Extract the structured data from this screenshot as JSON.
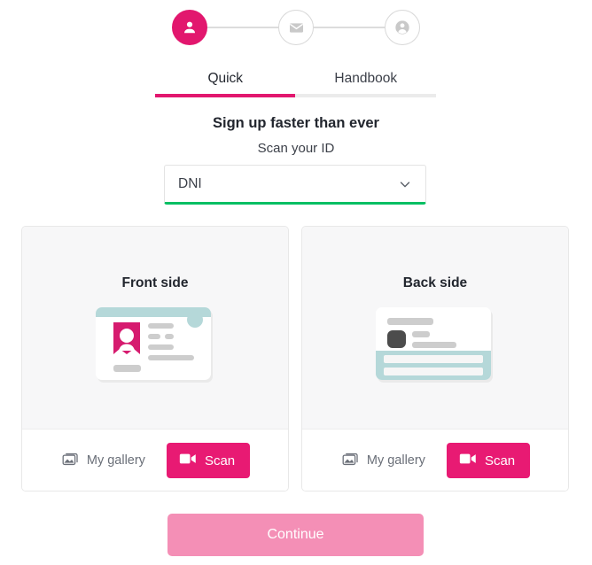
{
  "stepper": {
    "steps": [
      {
        "icon": "person-icon",
        "state": "active"
      },
      {
        "icon": "envelope-icon",
        "state": "inactive"
      },
      {
        "icon": "account-circle-icon",
        "state": "inactive"
      }
    ]
  },
  "tabs": [
    {
      "label": "Quick",
      "active": true
    },
    {
      "label": "Handbook",
      "active": false
    }
  ],
  "headings": {
    "title": "Sign up faster than ever",
    "subtitle": "Scan your ID"
  },
  "document_select": {
    "value": "DNI",
    "icon": "chevron-down-icon",
    "options": [
      "DNI"
    ]
  },
  "cards": [
    {
      "title": "Front side",
      "illustration": "id-card-front-illustration",
      "gallery_label": "My gallery",
      "gallery_icon": "image-icon",
      "scan_label": "Scan",
      "scan_icon": "video-camera-icon"
    },
    {
      "title": "Back side",
      "illustration": "id-card-back-illustration",
      "gallery_label": "My gallery",
      "gallery_icon": "image-icon",
      "scan_label": "Scan",
      "scan_icon": "video-camera-icon"
    }
  ],
  "continue_button": {
    "label": "Continue",
    "disabled": true
  },
  "colors": {
    "brand_pink": "#e2176e",
    "scan_pink": "#e81a73",
    "continue_pink": "#f48fb6",
    "accent_green": "#00bf63",
    "teal": "#b5d8d9",
    "card_bg": "#f7f7f8",
    "border_gray": "#e8e8e8",
    "text_dark": "#22262e",
    "text_muted": "#6a6f78"
  }
}
